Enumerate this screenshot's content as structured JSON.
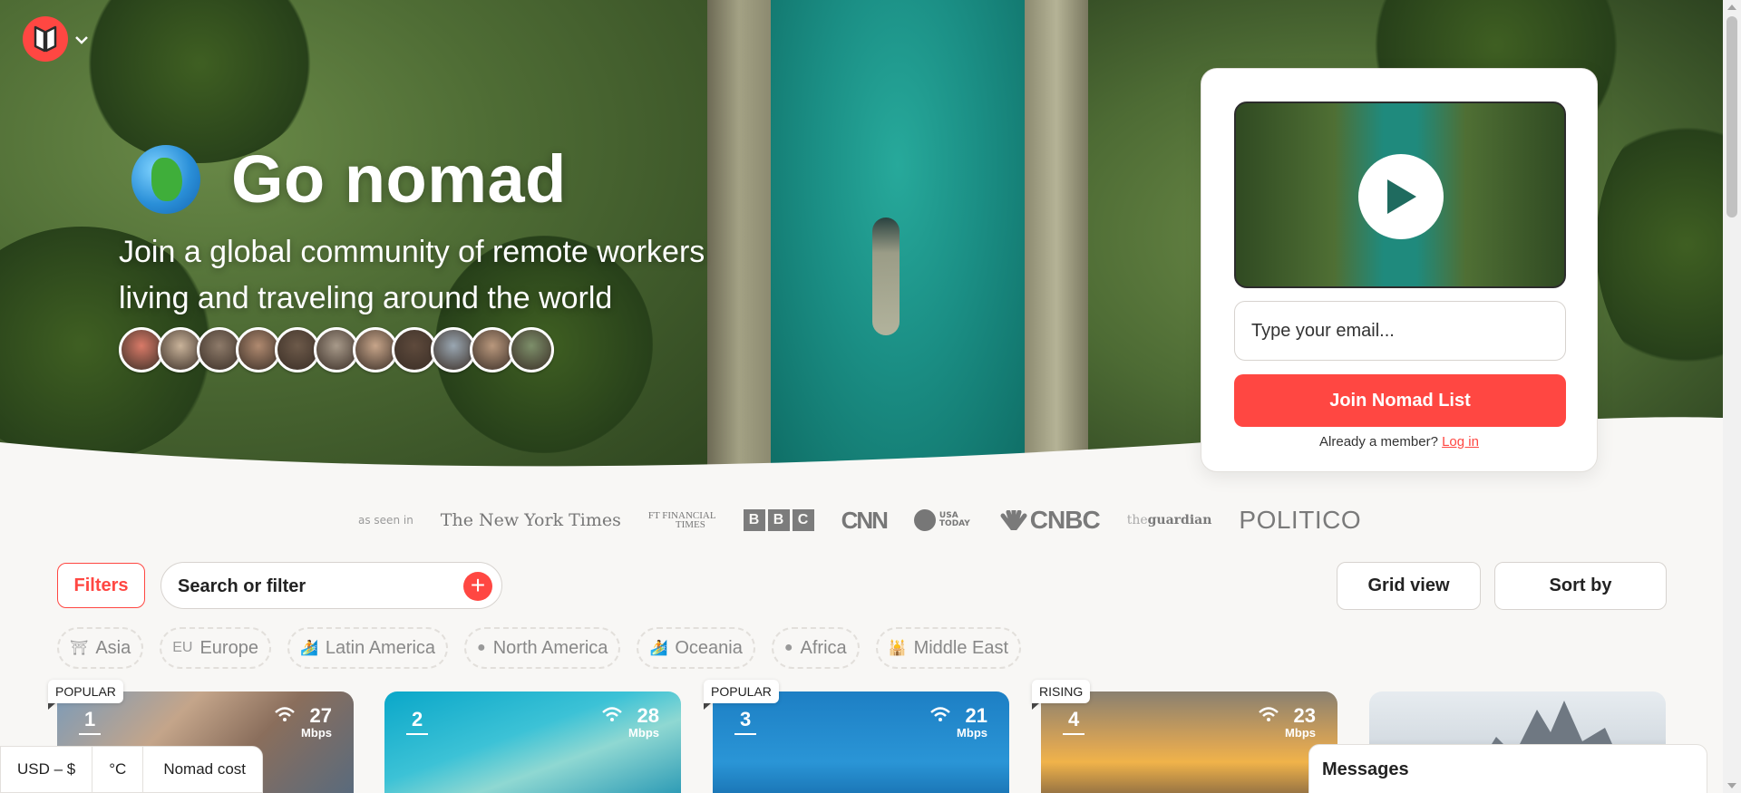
{
  "hero": {
    "title": "Go nomad",
    "subtitle": "Join a global community of remote workers living and traveling around the world",
    "avatar_colors": [
      "#d97a68",
      "#c9b39a",
      "#8e7b6a",
      "#b08a70",
      "#6d5a4a",
      "#a89a8a",
      "#c7a58a",
      "#5e4a3c",
      "#9aa7b2",
      "#b9987d",
      "#7d8f6a"
    ]
  },
  "signup": {
    "email_placeholder": "Type your email...",
    "join_label": "Join Nomad List",
    "member_text": "Already a member?",
    "login_label": "Log in"
  },
  "press": {
    "as_seen_in": "as seen in",
    "nyt": "The New York Times",
    "ft_line1": "FT FINANCIAL",
    "ft_line2": "TIMES",
    "bbc": [
      "B",
      "B",
      "C"
    ],
    "cnn": "CNN",
    "usa_line1": "USA",
    "usa_line2": "TODAY",
    "cnbc": "CNBC",
    "guardian_prefix": "the",
    "guardian": "guardian",
    "politico": "POLITICO"
  },
  "toolbar": {
    "filters_label": "Filters",
    "search_placeholder": "Search or filter",
    "grid_label": "Grid view",
    "sort_label": "Sort by"
  },
  "regions": [
    {
      "label": "Asia",
      "icon": "⛩"
    },
    {
      "label": "Europe",
      "icon": "EU"
    },
    {
      "label": "Latin America",
      "icon": "🏄"
    },
    {
      "label": "North America",
      "icon": "●"
    },
    {
      "label": "Oceania",
      "icon": "🏄"
    },
    {
      "label": "Africa",
      "icon": "●"
    },
    {
      "label": "Middle East",
      "icon": "🕌"
    }
  ],
  "cities": [
    {
      "rank": "1",
      "speed": "27",
      "unit": "Mbps",
      "tag": "POPULAR"
    },
    {
      "rank": "2",
      "speed": "28",
      "unit": "Mbps",
      "tag": ""
    },
    {
      "rank": "3",
      "speed": "21",
      "unit": "Mbps",
      "tag": "POPULAR"
    },
    {
      "rank": "4",
      "speed": "23",
      "unit": "Mbps",
      "tag": "RISING"
    }
  ],
  "footer": {
    "currency": "USD – $",
    "temp": "°C",
    "cost": "Nomad cost",
    "messages": "Messages"
  },
  "colors": {
    "accent": "#ff4742"
  }
}
